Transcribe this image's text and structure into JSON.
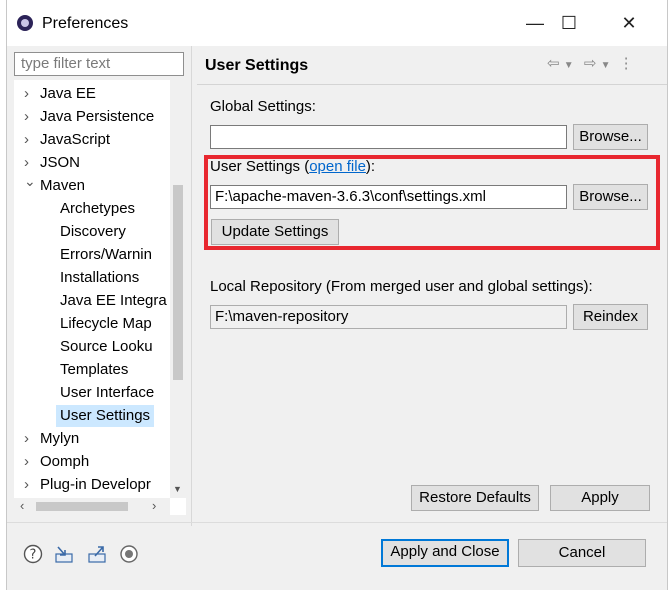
{
  "window": {
    "title": "Preferences",
    "minimize": "—",
    "maximize": "☐",
    "close": "✕"
  },
  "sidebar": {
    "filter_placeholder": "type filter text",
    "items": [
      {
        "label": "Java EE",
        "level": 0,
        "state": "collapsed"
      },
      {
        "label": "Java Persistence",
        "level": 0,
        "state": "collapsed"
      },
      {
        "label": "JavaScript",
        "level": 0,
        "state": "collapsed"
      },
      {
        "label": "JSON",
        "level": 0,
        "state": "collapsed"
      },
      {
        "label": "Maven",
        "level": 0,
        "state": "expanded"
      },
      {
        "label": "Archetypes",
        "level": 1
      },
      {
        "label": "Discovery",
        "level": 1
      },
      {
        "label": "Errors/Warnin",
        "level": 1
      },
      {
        "label": "Installations",
        "level": 1
      },
      {
        "label": "Java EE Integra",
        "level": 1
      },
      {
        "label": "Lifecycle Map",
        "level": 1
      },
      {
        "label": "Source Looku",
        "level": 1
      },
      {
        "label": "Templates",
        "level": 1
      },
      {
        "label": "User Interface",
        "level": 1
      },
      {
        "label": "User Settings",
        "level": 1,
        "selected": true
      },
      {
        "label": "Mylyn",
        "level": 0,
        "state": "collapsed"
      },
      {
        "label": "Oomph",
        "level": 0,
        "state": "collapsed"
      },
      {
        "label": "Plug-in Developr",
        "level": 0,
        "state": "collapsed"
      }
    ]
  },
  "page": {
    "title": "User Settings",
    "global_settings_label": "Global Settings:",
    "global_settings_value": "",
    "global_browse": "Browse...",
    "user_settings_label": "User Settings (",
    "user_settings_link": "open file",
    "user_settings_label_end": "):",
    "user_settings_value": "F:\\apache-maven-3.6.3\\conf\\settings.xml",
    "user_browse": "Browse...",
    "update_settings": "Update Settings",
    "local_repo_label": "Local Repository (From merged user and global settings):",
    "local_repo_value": "F:\\maven-repository",
    "reindex": "Reindex",
    "restore_defaults": "Restore Defaults",
    "apply": "Apply"
  },
  "footer": {
    "apply_close": "Apply and Close",
    "cancel": "Cancel",
    "icons": [
      "help-icon",
      "import-icon",
      "export-icon",
      "record-icon"
    ]
  },
  "colors": {
    "highlight": "#e8272f",
    "selection": "#cce8ff",
    "accent": "#0078d7",
    "link": "#0066cc"
  }
}
